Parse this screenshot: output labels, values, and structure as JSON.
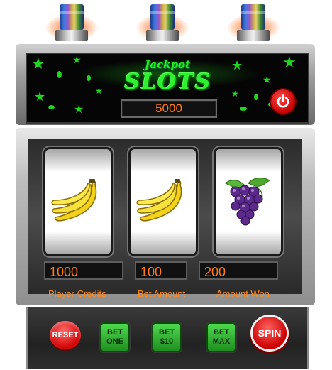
{
  "top": {
    "title_small": "Jackpot",
    "title_big": "SLOTS",
    "jackpot_value": "5000"
  },
  "reels": [
    {
      "symbol": "banana-icon"
    },
    {
      "symbol": "banana-icon"
    },
    {
      "symbol": "grapes-icon"
    }
  ],
  "stats": {
    "player_credits": {
      "label": "Player Credits",
      "value": "1000"
    },
    "bet_amount": {
      "label": "Bet Amount",
      "value": "100"
    },
    "amount_won": {
      "label": "Amount Won",
      "value": "200"
    }
  },
  "controls": {
    "reset": "RESET",
    "bet_one": {
      "line1": "BET",
      "line2": "ONE"
    },
    "bet_ten": {
      "line1": "BET",
      "line2": "$10"
    },
    "bet_max": {
      "line1": "BET",
      "line2": "MAX"
    },
    "spin": "SPIN"
  },
  "colors": {
    "screen_green": "#1ed620",
    "value_orange": "#ff7a1a",
    "button_red": "#d00000",
    "button_green": "#2fb52f"
  }
}
